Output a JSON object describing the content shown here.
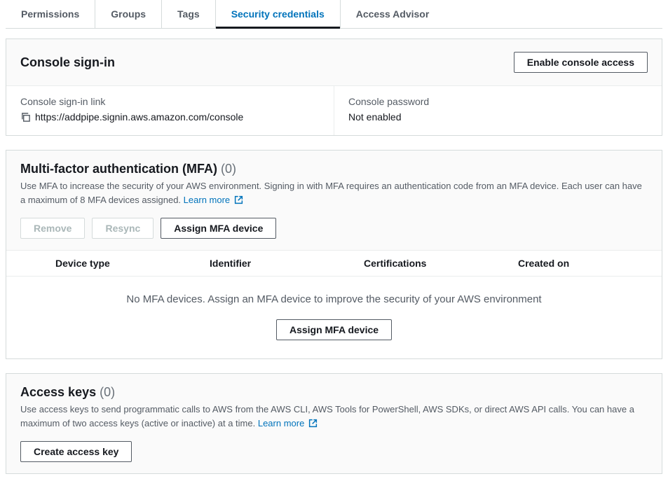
{
  "tabs": {
    "permissions": "Permissions",
    "groups": "Groups",
    "tags": "Tags",
    "security": "Security credentials",
    "advisor": "Access Advisor"
  },
  "console": {
    "title": "Console sign-in",
    "enable_btn": "Enable console access",
    "link_label": "Console sign-in link",
    "link_value": "https://addpipe.signin.aws.amazon.com/console",
    "pwd_label": "Console password",
    "pwd_value": "Not enabled"
  },
  "mfa": {
    "title": "Multi-factor authentication (MFA)",
    "count": "(0)",
    "desc": "Use MFA to increase the security of your AWS environment. Signing in with MFA requires an authentication code from an MFA device. Each user can have a maximum of 8 MFA devices assigned.",
    "learn": "Learn more",
    "remove": "Remove",
    "resync": "Resync",
    "assign": "Assign MFA device",
    "cols": {
      "type": "Device type",
      "id": "Identifier",
      "cert": "Certifications",
      "created": "Created on"
    },
    "empty": "No MFA devices. Assign an MFA device to improve the security of your AWS environment",
    "assign2": "Assign MFA device"
  },
  "keys": {
    "title": "Access keys",
    "count": "(0)",
    "desc": "Use access keys to send programmatic calls to AWS from the AWS CLI, AWS Tools for PowerShell, AWS SDKs, or direct AWS API calls. You can have a maximum of two access keys (active or inactive) at a time.",
    "learn": "Learn more",
    "create": "Create access key"
  }
}
